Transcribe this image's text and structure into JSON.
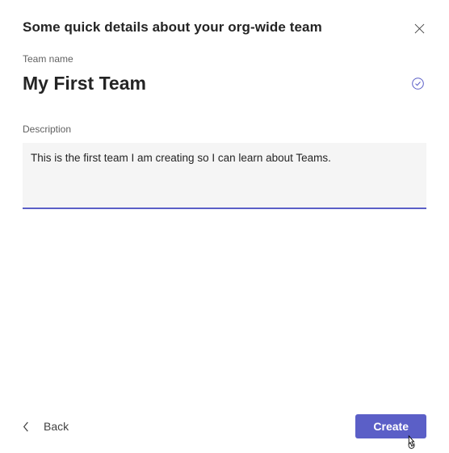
{
  "header": {
    "title": "Some quick details about your org-wide team"
  },
  "teamName": {
    "label": "Team name",
    "value": "My First Team"
  },
  "description": {
    "label": "Description",
    "value": "This is the first team I am creating so I can learn about Teams."
  },
  "footer": {
    "backLabel": "Back",
    "createLabel": "Create"
  }
}
